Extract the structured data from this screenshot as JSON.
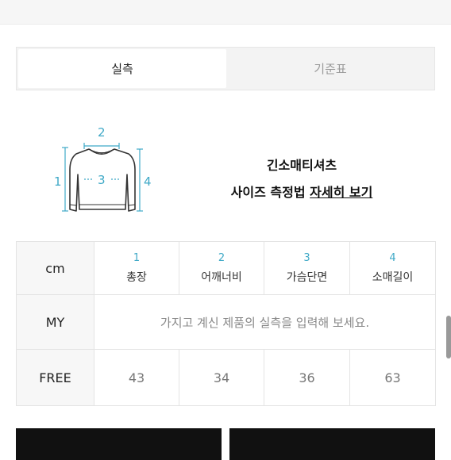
{
  "tabs": [
    {
      "label": "실측",
      "active": true
    },
    {
      "label": "기준표",
      "active": false
    }
  ],
  "diagram": {
    "labels": [
      "1",
      "2",
      "3",
      "4"
    ],
    "accent_color": "#3fa9c7"
  },
  "product": {
    "name": "긴소매티셔츠",
    "guide_prefix": "사이즈 측정법 ",
    "guide_link": "자세히 보기"
  },
  "table": {
    "corner": "cm",
    "columns": [
      {
        "num": "1",
        "name": "총장"
      },
      {
        "num": "2",
        "name": "어깨너비"
      },
      {
        "num": "3",
        "name": "가슴단면"
      },
      {
        "num": "4",
        "name": "소매길이"
      }
    ],
    "my_row": {
      "label": "MY",
      "placeholder": "가지고 계신 제품의 실측을 입력해 보세요."
    },
    "free_row": {
      "label": "FREE",
      "values": [
        "43",
        "34",
        "36",
        "63"
      ]
    }
  },
  "buttons": {
    "left_label": "",
    "right_label": ""
  }
}
